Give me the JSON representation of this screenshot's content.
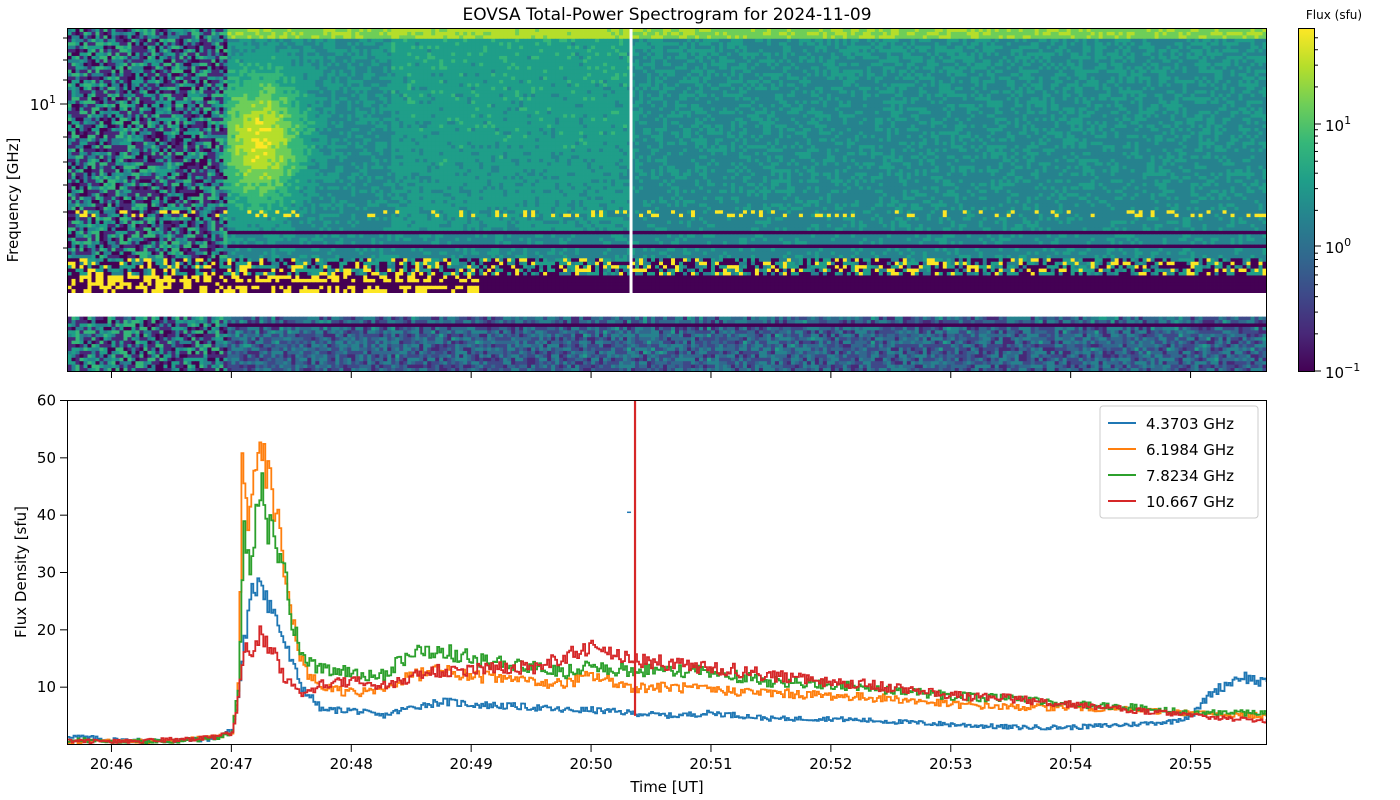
{
  "figure": {
    "title": "EOVSA Total-Power Spectrogram for 2024-11-09"
  },
  "colors": {
    "viridis": [
      "#440154",
      "#482878",
      "#3e4989",
      "#31688e",
      "#26828e",
      "#1f9e89",
      "#35b779",
      "#6ece58",
      "#b5de2b",
      "#fde725"
    ],
    "series": [
      "#1f77b4",
      "#ff7f0e",
      "#2ca02c",
      "#d62728"
    ],
    "gap": "#ffffff"
  },
  "chart_data": [
    {
      "type": "heatmap",
      "ylabel": "Frequency [GHz]",
      "yscale": "log",
      "y_ticks": [
        {
          "value": 10,
          "label": "10"
        }
      ],
      "y_tick_exponent": "1",
      "xlim": [
        "20:45:38",
        "20:55:38"
      ],
      "x_ticks": [
        "20:46",
        "20:47",
        "20:48",
        "20:49",
        "20:50",
        "20:51",
        "20:52",
        "20:53",
        "20:54",
        "20:55"
      ],
      "x_ticklabels_visible": false,
      "colorbar": {
        "label": "Flux (sfu)",
        "scale": "log",
        "range": [
          0.1,
          60
        ],
        "ticks": [
          {
            "base": "10",
            "exp": "1",
            "value": 10
          },
          {
            "base": "10",
            "exp": "0",
            "value": 1
          },
          {
            "base": "10",
            "exp": "−1",
            "value": 0.1
          }
        ]
      },
      "features": {
        "burst_peak_time": "20:47:14",
        "data_gap_time": "20:50:20"
      }
    },
    {
      "type": "line",
      "xlabel": "Time [UT]",
      "ylabel": "Flux Density [sfu]",
      "ylim": [
        0,
        60
      ],
      "y_ticks": [
        10,
        20,
        30,
        40,
        50,
        60
      ],
      "xlim": [
        "20:45:38",
        "20:55:38"
      ],
      "x_ticks": [
        "20:46",
        "20:47",
        "20:48",
        "20:49",
        "20:50",
        "20:51",
        "20:52",
        "20:53",
        "20:54",
        "20:55"
      ],
      "legend_position": "top-right",
      "series": [
        {
          "name": "4.3703 GHz",
          "points": [
            [
              "20:45:38",
              1.5
            ],
            [
              "20:46:00",
              0.8
            ],
            [
              "20:46:30",
              0.6
            ],
            [
              "20:46:50",
              1.0
            ],
            [
              "20:47:00",
              2.5
            ],
            [
              "20:47:03",
              8.0
            ],
            [
              "20:47:06",
              18.0
            ],
            [
              "20:47:10",
              26.0
            ],
            [
              "20:47:14",
              30.0
            ],
            [
              "20:47:18",
              25.0
            ],
            [
              "20:47:22",
              22.0
            ],
            [
              "20:47:26",
              18.0
            ],
            [
              "20:47:30",
              14.0
            ],
            [
              "20:47:35",
              10.0
            ],
            [
              "20:47:45",
              6.0
            ],
            [
              "20:48:00",
              6.0
            ],
            [
              "20:48:15",
              5.0
            ],
            [
              "20:48:30",
              6.5
            ],
            [
              "20:48:45",
              7.5
            ],
            [
              "20:49:00",
              7.0
            ],
            [
              "20:49:30",
              6.5
            ],
            [
              "20:49:45",
              6.0
            ],
            [
              "20:50:00",
              6.0
            ],
            [
              "20:50:20",
              5.5
            ],
            [
              "20:50:40",
              5.0
            ],
            [
              "20:51:00",
              5.5
            ],
            [
              "20:51:30",
              4.5
            ],
            [
              "20:52:00",
              4.5
            ],
            [
              "20:52:30",
              4.0
            ],
            [
              "20:53:00",
              3.5
            ],
            [
              "20:53:30",
              3.0
            ],
            [
              "20:54:00",
              3.0
            ],
            [
              "20:54:30",
              3.5
            ],
            [
              "20:54:50",
              4.0
            ],
            [
              "20:55:00",
              5.0
            ],
            [
              "20:55:10",
              9.0
            ],
            [
              "20:55:25",
              12.0
            ],
            [
              "20:55:38",
              10.5
            ]
          ]
        },
        {
          "name": "6.1984 GHz",
          "points": [
            [
              "20:45:38",
              0.5
            ],
            [
              "20:46:00",
              0.5
            ],
            [
              "20:46:30",
              0.6
            ],
            [
              "20:46:50",
              1.2
            ],
            [
              "20:47:00",
              2.0
            ],
            [
              "20:47:03",
              10.0
            ],
            [
              "20:47:05",
              47.0
            ],
            [
              "20:47:08",
              38.0
            ],
            [
              "20:47:11",
              48.0
            ],
            [
              "20:47:14",
              55.0
            ],
            [
              "20:47:17",
              48.0
            ],
            [
              "20:47:20",
              45.0
            ],
            [
              "20:47:23",
              38.0
            ],
            [
              "20:47:27",
              30.0
            ],
            [
              "20:47:31",
              20.0
            ],
            [
              "20:47:36",
              13.0
            ],
            [
              "20:47:45",
              10.0
            ],
            [
              "20:48:00",
              9.0
            ],
            [
              "20:48:15",
              9.5
            ],
            [
              "20:48:30",
              12.0
            ],
            [
              "20:48:45",
              13.0
            ],
            [
              "20:49:00",
              12.0
            ],
            [
              "20:49:30",
              11.0
            ],
            [
              "20:49:45",
              10.5
            ],
            [
              "20:50:00",
              12.0
            ],
            [
              "20:50:20",
              10.0
            ],
            [
              "20:50:40",
              10.0
            ],
            [
              "20:51:00",
              9.5
            ],
            [
              "20:51:30",
              9.0
            ],
            [
              "20:52:00",
              8.5
            ],
            [
              "20:52:30",
              8.0
            ],
            [
              "20:53:00",
              7.0
            ],
            [
              "20:53:30",
              6.5
            ],
            [
              "20:54:00",
              6.5
            ],
            [
              "20:54:30",
              6.0
            ],
            [
              "20:55:00",
              5.5
            ],
            [
              "20:55:38",
              5.0
            ]
          ]
        },
        {
          "name": "7.8234 GHz",
          "points": [
            [
              "20:45:38",
              0.8
            ],
            [
              "20:46:00",
              0.6
            ],
            [
              "20:46:30",
              0.6
            ],
            [
              "20:46:50",
              1.0
            ],
            [
              "20:47:00",
              2.0
            ],
            [
              "20:47:03",
              10.0
            ],
            [
              "20:47:06",
              36.0
            ],
            [
              "20:47:09",
              30.0
            ],
            [
              "20:47:12",
              40.0
            ],
            [
              "20:47:15",
              44.0
            ],
            [
              "20:47:18",
              38.0
            ],
            [
              "20:47:22",
              35.0
            ],
            [
              "20:47:26",
              30.0
            ],
            [
              "20:47:30",
              22.0
            ],
            [
              "20:47:35",
              15.0
            ],
            [
              "20:47:45",
              13.0
            ],
            [
              "20:48:00",
              12.5
            ],
            [
              "20:48:15",
              12.0
            ],
            [
              "20:48:30",
              16.0
            ],
            [
              "20:48:45",
              16.5
            ],
            [
              "20:49:00",
              15.0
            ],
            [
              "20:49:30",
              13.5
            ],
            [
              "20:49:45",
              12.5
            ],
            [
              "20:50:00",
              13.5
            ],
            [
              "20:50:20",
              13.0
            ],
            [
              "20:50:40",
              13.0
            ],
            [
              "20:51:00",
              12.5
            ],
            [
              "20:51:30",
              11.0
            ],
            [
              "20:52:00",
              10.5
            ],
            [
              "20:52:30",
              9.5
            ],
            [
              "20:53:00",
              8.5
            ],
            [
              "20:53:30",
              8.0
            ],
            [
              "20:54:00",
              7.0
            ],
            [
              "20:54:30",
              6.5
            ],
            [
              "20:55:00",
              5.5
            ],
            [
              "20:55:38",
              5.5
            ]
          ]
        },
        {
          "name": "10.667 GHz",
          "points": [
            [
              "20:45:38",
              0.5
            ],
            [
              "20:46:00",
              0.5
            ],
            [
              "20:46:30",
              0.8
            ],
            [
              "20:46:50",
              1.2
            ],
            [
              "20:47:00",
              2.0
            ],
            [
              "20:47:03",
              8.0
            ],
            [
              "20:47:06",
              17.0
            ],
            [
              "20:47:10",
              15.0
            ],
            [
              "20:47:14",
              20.0
            ],
            [
              "20:47:18",
              17.0
            ],
            [
              "20:47:22",
              15.0
            ],
            [
              "20:47:26",
              12.0
            ],
            [
              "20:47:30",
              10.0
            ],
            [
              "20:47:35",
              9.0
            ],
            [
              "20:47:45",
              10.5
            ],
            [
              "20:48:00",
              11.0
            ],
            [
              "20:48:15",
              10.0
            ],
            [
              "20:48:30",
              12.0
            ],
            [
              "20:48:45",
              13.0
            ],
            [
              "20:49:00",
              13.0
            ],
            [
              "20:49:30",
              13.5
            ],
            [
              "20:49:45",
              15.0
            ],
            [
              "20:50:00",
              17.0
            ],
            [
              "20:50:20",
              15.0
            ],
            [
              "20:50:40",
              14.0
            ],
            [
              "20:51:00",
              13.5
            ],
            [
              "20:51:30",
              12.0
            ],
            [
              "20:52:00",
              11.0
            ],
            [
              "20:52:30",
              10.0
            ],
            [
              "20:53:00",
              8.5
            ],
            [
              "20:53:30",
              8.0
            ],
            [
              "20:54:00",
              7.0
            ],
            [
              "20:54:30",
              6.0
            ],
            [
              "20:55:00",
              5.0
            ],
            [
              "20:55:38",
              4.0
            ]
          ]
        }
      ],
      "spike": {
        "time": "20:50:22",
        "series": "10.667 GHz",
        "ymin": 5,
        "ymax": 60
      },
      "blip": {
        "time": "20:50:19",
        "series": "4.3703 GHz",
        "value": 40.5
      }
    }
  ]
}
